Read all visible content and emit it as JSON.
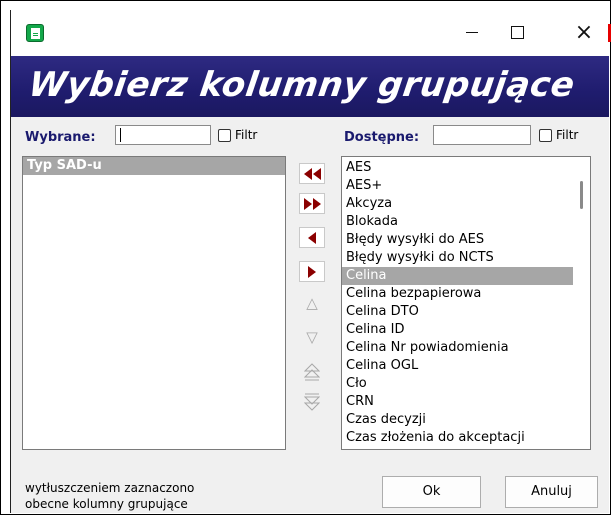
{
  "titlebar": {
    "app_icon": "spreadsheet-icon",
    "minimize": "minimize-icon",
    "maximize": "maximize-icon",
    "close_glyph": "×"
  },
  "banner": {
    "title": "Wybierz kolumny grupujące"
  },
  "left": {
    "label": "Wybrane:",
    "search_value": "",
    "filter_label": "Filtr",
    "items": [
      {
        "text": "Typ SAD-u",
        "selected": true,
        "bold": true
      }
    ]
  },
  "right": {
    "label": "Dostępne:",
    "search_value": "",
    "filter_label": "Filtr",
    "items": [
      "AES",
      "AES+",
      "Akcyza",
      "Blokada",
      "Błędy wysyłki do AES",
      "Błędy wysyłki do NCTS",
      "Celina",
      "Celina bezpapierowa",
      "Celina DTO",
      "Celina ID",
      "Celina Nr powiadomienia",
      "Celina OGL",
      "Cło",
      "CRN",
      "Czas decyzji",
      "Czas złożenia do akceptacji"
    ],
    "selected_index": 6
  },
  "transfer_buttons": [
    {
      "name": "move-all-left-button",
      "icon": "double-left-arrow-icon",
      "enabled": true
    },
    {
      "name": "move-all-right-button",
      "icon": "double-right-arrow-icon",
      "enabled": true
    },
    {
      "name": "move-left-button",
      "icon": "left-arrow-icon",
      "enabled": true
    },
    {
      "name": "move-right-button",
      "icon": "right-arrow-icon",
      "enabled": true
    },
    {
      "name": "move-up-button",
      "icon": "up-arrow-icon",
      "enabled": false
    },
    {
      "name": "move-down-button",
      "icon": "down-arrow-icon",
      "enabled": false
    },
    {
      "name": "move-top-button",
      "icon": "move-top-icon",
      "enabled": false
    },
    {
      "name": "move-bottom-button",
      "icon": "move-bottom-icon",
      "enabled": false
    }
  ],
  "footer": {
    "hint_line1": "wytłuszczeniem zaznaczono",
    "hint_line2": "obecne kolumny grupujące",
    "ok_label": "Ok",
    "cancel_label": "Anuluj"
  },
  "colors": {
    "banner": "#1f1c6e",
    "label": "#1a1a6e",
    "arrow": "#8b0000",
    "selection": "#a6a6a6"
  }
}
